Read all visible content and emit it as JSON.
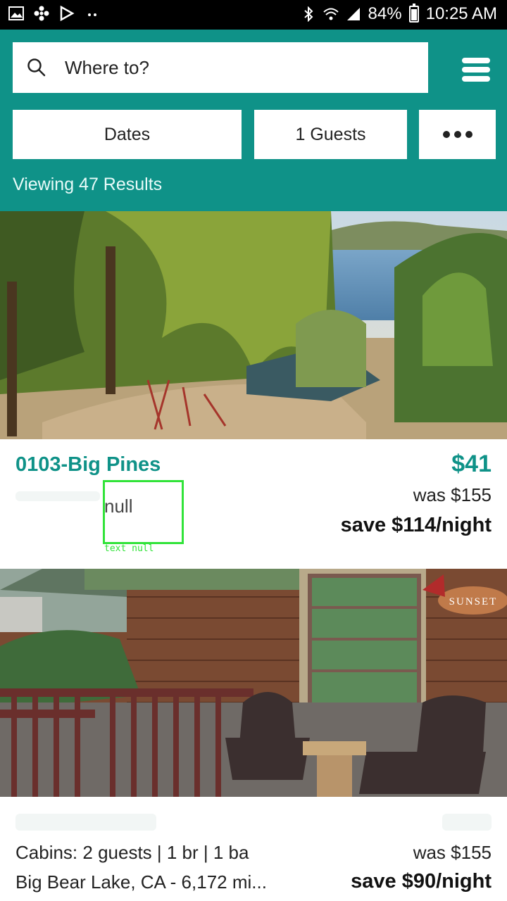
{
  "status_bar": {
    "battery": "84%",
    "time": "10:25 AM"
  },
  "header": {
    "search_placeholder": "Where to?",
    "dates_label": "Dates",
    "guests_label": "1 Guests",
    "results_text": "Viewing 47 Results"
  },
  "listings": [
    {
      "title": "0103-Big Pines",
      "price": "$41",
      "was": "was $155",
      "save": "save $114/night",
      "debug_label": "null",
      "debug_caption": "text null"
    },
    {
      "meta": "Cabins: 2 guests | 1 br | 1 ba",
      "location": "Big Bear Lake, CA - 6,172 mi...",
      "was": "was $155",
      "save": "save $90/night",
      "sign_text": "SUNSET"
    }
  ],
  "colors": {
    "brand": "#0f9288",
    "debug": "#31e339"
  }
}
